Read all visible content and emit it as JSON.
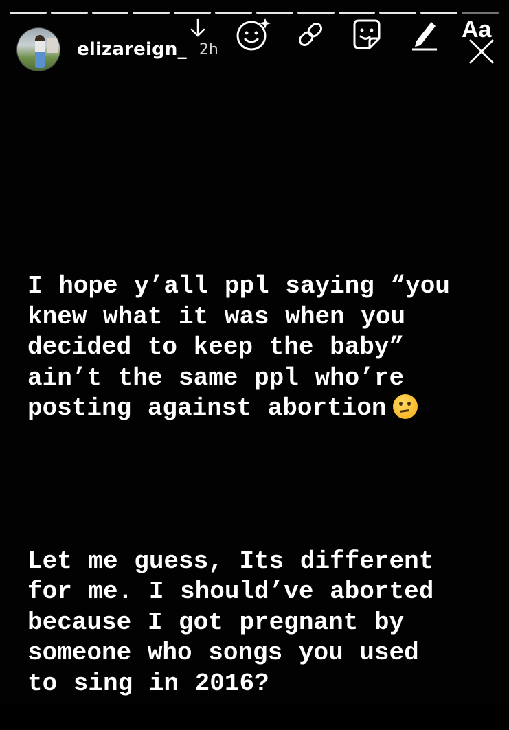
{
  "story": {
    "progress": {
      "total_segments": 12,
      "completed_segments": 11
    },
    "user": {
      "username": "elizareign_",
      "time_ago": "2h"
    },
    "toolbar": {
      "icons": [
        "download-icon",
        "sticker-icon",
        "link-icon",
        "face-sticker-icon",
        "draw-icon",
        "text-icon",
        "close-icon"
      ],
      "text_tool_label": "Aa"
    },
    "text": {
      "paragraph1": "I hope y’all ppl saying “you\nknew what it was when you\ndecided to keep the baby”\nain’t the same ppl who’re\nposting against abortion",
      "paragraph1_emoji": "thinking-face-emoji",
      "paragraph2": "Let me guess, Its different\nfor me. I should’ve aborted\nbecause I got pregnant by\nsomeone who songs you used\nto sing in 2016?"
    },
    "colors": {
      "background": "#020202",
      "text": "#ffffff"
    }
  }
}
